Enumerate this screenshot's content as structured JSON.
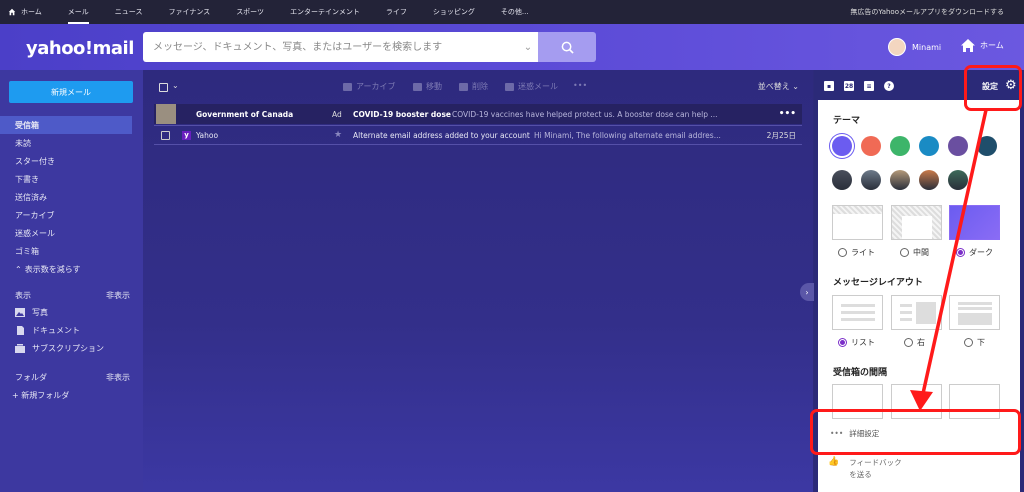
{
  "topnav": {
    "items": [
      "ホーム",
      "メール",
      "ニュース",
      "ファイナンス",
      "スポーツ",
      "エンターテインメント",
      "ライフ",
      "ショッピング",
      "その他..."
    ],
    "promo": "無広告のYahooメールアプリをダウンロードする"
  },
  "header": {
    "logo": "yahoo!mail",
    "search_placeholder": "メッセージ、ドキュメント、写真、またはユーザーを検索します",
    "user_name": "Minami",
    "home_label": "ホーム"
  },
  "sidebar": {
    "compose": "新規メール",
    "items": [
      "受信箱",
      "未読",
      "スター付き",
      "下書き",
      "送信済み",
      "アーカイブ",
      "迷惑メール",
      "ゴミ箱",
      "表示数を減らす"
    ],
    "view_label": "表示",
    "hide_label": "非表示",
    "view_items": [
      "写真",
      "ドキュメント",
      "サブスクリプション"
    ],
    "folders_label": "フォルダ",
    "folders_hide": "非表示",
    "new_folder": "+ 新規フォルダ"
  },
  "toolbar": {
    "archive": "アーカイブ",
    "move": "移動",
    "delete": "削除",
    "spam": "迷惑メール",
    "more": "•••",
    "sort": "並べ替え"
  },
  "mails": [
    {
      "from": "Government of Canada",
      "tag": "Ad",
      "subject": "COVID-19 booster dose",
      "snippet": "COVID-19 vaccines have helped protect us. A booster dose can help ...",
      "more": "•••"
    },
    {
      "from": "Yahoo",
      "subject": "Alternate email address added to your account",
      "snippet": "Hi Minami, The following alternate email addres...",
      "date": "2月25日"
    }
  ],
  "settings": {
    "label": "設定",
    "theme_title": "テーマ",
    "theme_colors": [
      "#6b5cf0",
      "#f06a55",
      "#3db56a",
      "#1a8bc4",
      "#6a4fa0",
      "#1f4e6b"
    ],
    "theme_photos": [
      "#4a4f5c",
      "#6d7a8a",
      "#b49a7a",
      "#c97a4a",
      "#3d6a5a"
    ],
    "modes": [
      "ライト",
      "中間",
      "ダーク"
    ],
    "layout_title": "メッセージレイアウト",
    "layouts": [
      "リスト",
      "右",
      "下"
    ],
    "spacing_title": "受信箱の間隔",
    "advanced": "詳細設定",
    "feedback_line1": "フィードバック",
    "feedback_line2": "を送る"
  }
}
